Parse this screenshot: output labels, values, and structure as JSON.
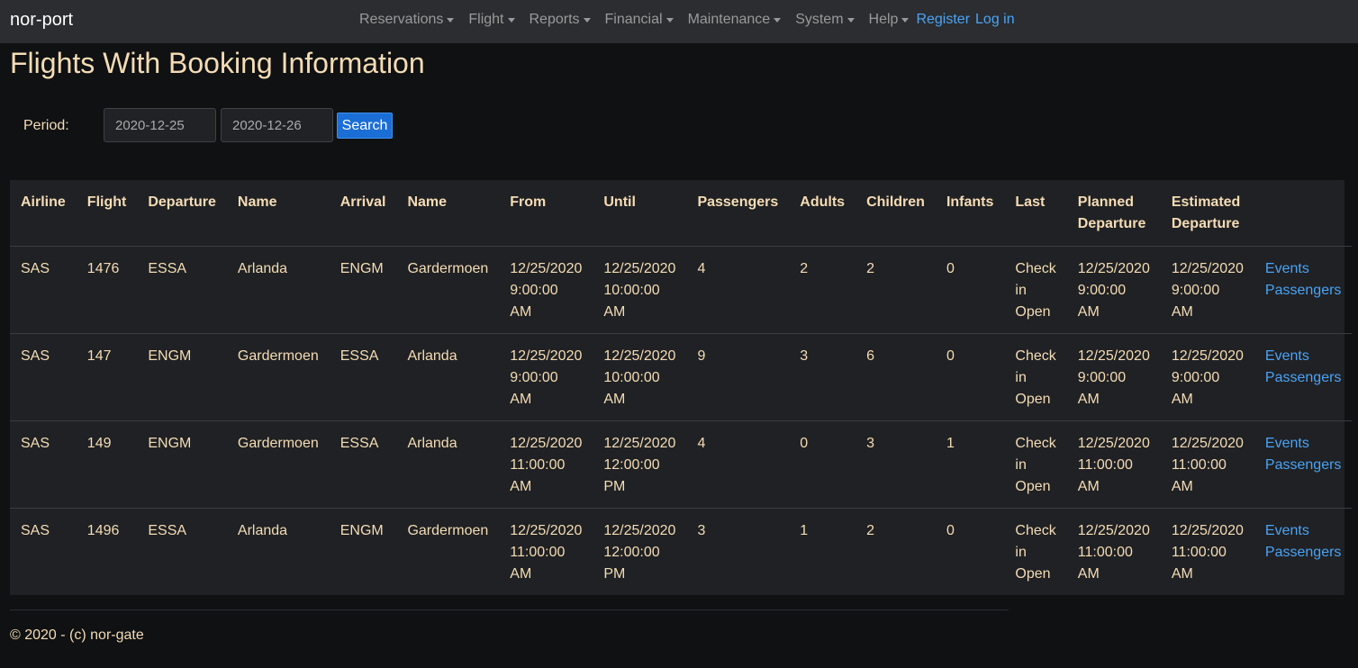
{
  "navbar": {
    "brand": "nor-port",
    "items": [
      {
        "label": "Reservations"
      },
      {
        "label": "Flight"
      },
      {
        "label": "Reports"
      },
      {
        "label": "Financial"
      },
      {
        "label": "Maintenance"
      },
      {
        "label": "System"
      },
      {
        "label": "Help"
      }
    ],
    "register_label": "Register",
    "login_label": "Log in"
  },
  "page": {
    "title": "Flights With Booking Information"
  },
  "search": {
    "period_label": "Period:",
    "from_value": "2020-12-25",
    "to_value": "2020-12-26",
    "button_label": "Search"
  },
  "table": {
    "headers": [
      "Airline",
      "Flight",
      "Departure",
      "Name",
      "Arrival",
      "Name",
      "From",
      "Until",
      "Passengers",
      "Adults",
      "Children",
      "Infants",
      "Last",
      "Planned Departure",
      "Estimated Departure",
      ""
    ],
    "rows": [
      {
        "airline": "SAS",
        "flight": "1476",
        "departure": "ESSA",
        "departure_name": "Arlanda",
        "arrival": "ENGM",
        "arrival_name": "Gardermoen",
        "from": "12/25/2020 9:00:00 AM",
        "until": "12/25/2020 10:00:00 AM",
        "passengers": "4",
        "adults": "2",
        "children": "2",
        "infants": "0",
        "last": "Check in Open",
        "planned": "12/25/2020 9:00:00 AM",
        "estimated": "12/25/2020 9:00:00 AM",
        "events_link": "Events",
        "passengers_link": "Passengers"
      },
      {
        "airline": "SAS",
        "flight": "147",
        "departure": "ENGM",
        "departure_name": "Gardermoen",
        "arrival": "ESSA",
        "arrival_name": "Arlanda",
        "from": "12/25/2020 9:00:00 AM",
        "until": "12/25/2020 10:00:00 AM",
        "passengers": "9",
        "adults": "3",
        "children": "6",
        "infants": "0",
        "last": "Check in Open",
        "planned": "12/25/2020 9:00:00 AM",
        "estimated": "12/25/2020 9:00:00 AM",
        "events_link": "Events",
        "passengers_link": "Passengers"
      },
      {
        "airline": "SAS",
        "flight": "149",
        "departure": "ENGM",
        "departure_name": "Gardermoen",
        "arrival": "ESSA",
        "arrival_name": "Arlanda",
        "from": "12/25/2020 11:00:00 AM",
        "until": "12/25/2020 12:00:00 PM",
        "passengers": "4",
        "adults": "0",
        "children": "3",
        "infants": "1",
        "last": "Check in Open",
        "planned": "12/25/2020 11:00:00 AM",
        "estimated": "12/25/2020 11:00:00 AM",
        "events_link": "Events",
        "passengers_link": "Passengers"
      },
      {
        "airline": "SAS",
        "flight": "1496",
        "departure": "ESSA",
        "departure_name": "Arlanda",
        "arrival": "ENGM",
        "arrival_name": "Gardermoen",
        "from": "12/25/2020 11:00:00 AM",
        "until": "12/25/2020 12:00:00 PM",
        "passengers": "3",
        "adults": "1",
        "children": "2",
        "infants": "0",
        "last": "Check in Open",
        "planned": "12/25/2020 11:00:00 AM",
        "estimated": "12/25/2020 11:00:00 AM",
        "events_link": "Events",
        "passengers_link": "Passengers"
      }
    ]
  },
  "footer": {
    "text": "© 2020 - (c) nor-gate"
  },
  "colors": {
    "background": "#0f1113",
    "navbar": "#2b2d30",
    "text": "#f5dcb4",
    "link": "#4ba3f5",
    "primary_button": "#1a6ed6",
    "table_background": "#1f2124"
  },
  "icons": {
    "dropdown": "caret-down-icon"
  }
}
